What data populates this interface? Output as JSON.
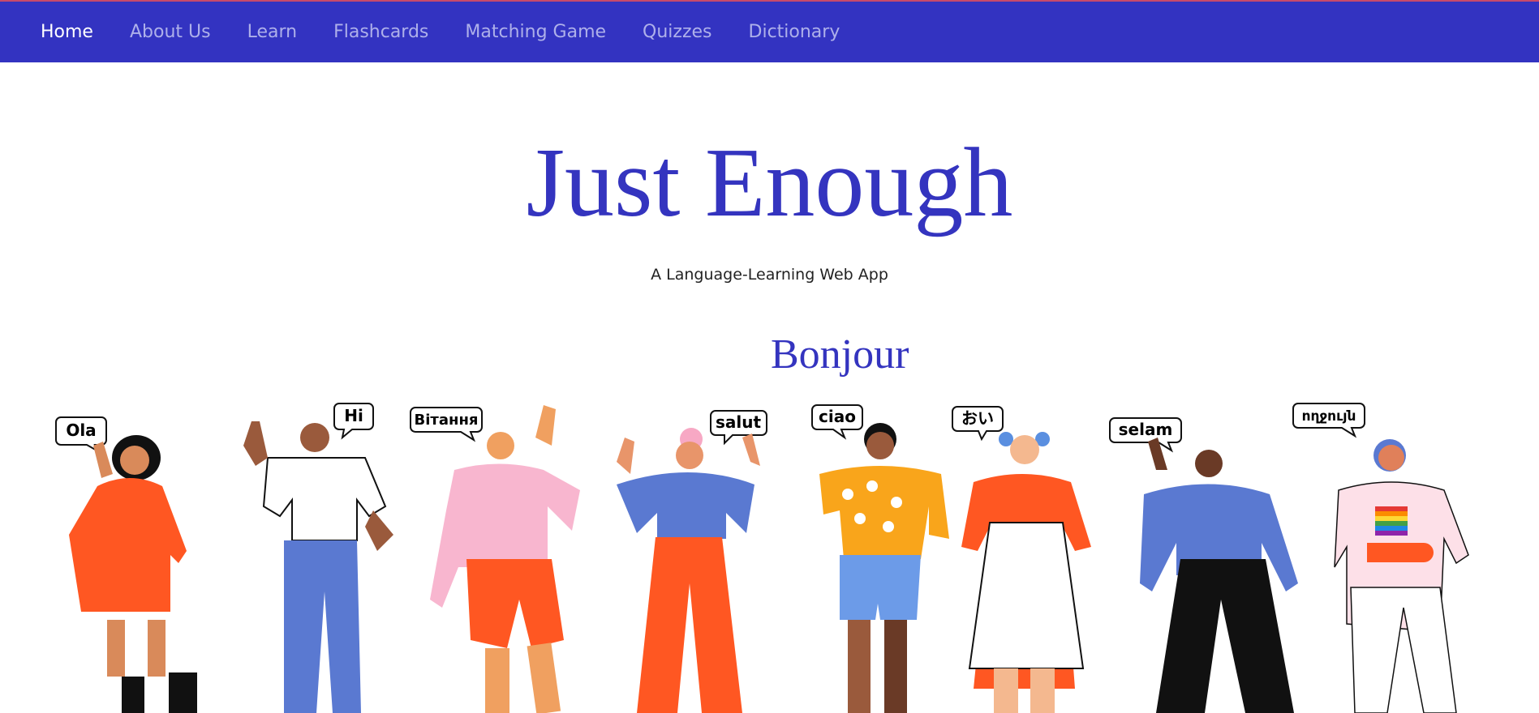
{
  "nav": {
    "items": [
      {
        "label": "Home",
        "active": true
      },
      {
        "label": "About Us"
      },
      {
        "label": "Learn"
      },
      {
        "label": "Flashcards"
      },
      {
        "label": "Matching Game"
      },
      {
        "label": "Quizzes"
      },
      {
        "label": "Dictionary"
      }
    ]
  },
  "hero": {
    "title": "Just Enough",
    "subtitle": "A Language-Learning Web App",
    "greeting": "Bonjour"
  },
  "illustration": {
    "speech_bubbles": [
      "Ola",
      "Hi",
      "Вітання",
      "salut",
      "ciao",
      "おい",
      "selam",
      "ողջույն"
    ]
  },
  "colors": {
    "nav_background": "#3333c1",
    "brand_blue": "#3434bf"
  }
}
